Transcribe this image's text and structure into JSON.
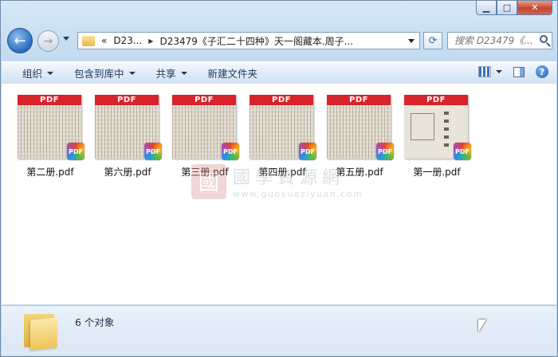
{
  "window": {
    "caption_buttons": {
      "minimize": "▁",
      "maximize": "□",
      "close": "✕"
    }
  },
  "nav": {
    "back_icon": "←",
    "forward_icon": "→",
    "breadcrumb_overflow": "«",
    "breadcrumb_root": "D23...",
    "breadcrumb_current": "D23479《子汇二十四种》天一阁藏本.周子...",
    "refresh_icon": "⟳",
    "search_placeholder": "搜索 D23479《..."
  },
  "toolbar": {
    "organize": "组织",
    "include_library": "包含到库中",
    "share": "共享",
    "new_folder": "新建文件夹",
    "help": "?"
  },
  "files": [
    {
      "name": "第二册.pdf",
      "banner": "PDF",
      "badge": "PDF",
      "thumb": "text"
    },
    {
      "name": "第六册.pdf",
      "banner": "PDF",
      "badge": "PDF",
      "thumb": "text"
    },
    {
      "name": "第三册.pdf",
      "banner": "PDF",
      "badge": "PDF",
      "thumb": "text"
    },
    {
      "name": "第四册.pdf",
      "banner": "PDF",
      "badge": "PDF",
      "thumb": "text"
    },
    {
      "name": "第五册.pdf",
      "banner": "PDF",
      "badge": "PDF",
      "thumb": "text"
    },
    {
      "name": "第一册.pdf",
      "banner": "PDF",
      "badge": "PDF",
      "thumb": "cover"
    }
  ],
  "watermark": {
    "seal": "國",
    "text": "國學資源網",
    "url": "www.guoxueziyuan.com"
  },
  "status": {
    "object_count": "6 个对象"
  }
}
